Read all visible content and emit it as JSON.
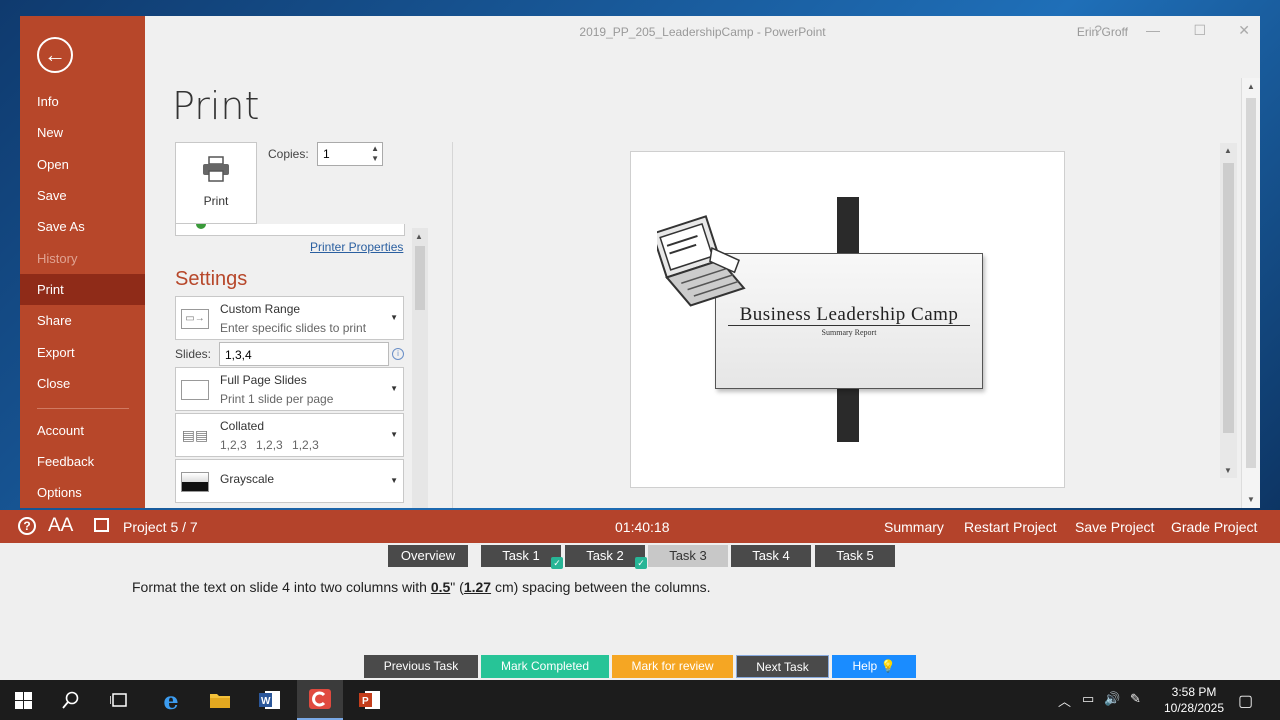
{
  "window": {
    "title": "2019_PP_205_LeadershipCamp  -  PowerPoint",
    "user": "Erin Groff",
    "help": "?",
    "minimize": "—",
    "maximize": "☐",
    "close": "✕"
  },
  "backstage": {
    "back": "←",
    "items": [
      {
        "label": "Info",
        "state": "normal"
      },
      {
        "label": "New",
        "state": "normal"
      },
      {
        "label": "Open",
        "state": "normal"
      },
      {
        "label": "Save",
        "state": "normal"
      },
      {
        "label": "Save As",
        "state": "normal"
      },
      {
        "label": "History",
        "state": "disabled"
      },
      {
        "label": "Print",
        "state": "active"
      },
      {
        "label": "Share",
        "state": "normal"
      },
      {
        "label": "Export",
        "state": "normal"
      },
      {
        "label": "Close",
        "state": "normal"
      },
      {
        "label": "Account",
        "state": "normal"
      },
      {
        "label": "Feedback",
        "state": "normal"
      },
      {
        "label": "Options",
        "state": "normal"
      }
    ]
  },
  "print": {
    "heading": "Print",
    "button_label": "Print",
    "copies_label": "Copies:",
    "copies_value": "1",
    "printer_properties": "Printer Properties",
    "settings_heading": "Settings",
    "range": {
      "title": "Custom Range",
      "subtitle": "Enter specific slides to print"
    },
    "slides_label": "Slides:",
    "slides_value": "1,3,4",
    "layout": {
      "title": "Full Page Slides",
      "subtitle": "Print 1 slide per page"
    },
    "collation": {
      "title": "Collated",
      "subtitle": "1,2,3   1,2,3   1,2,3"
    },
    "color": {
      "title": "Grayscale"
    }
  },
  "preview": {
    "slide_title": "Business Leadership Camp",
    "slide_subtitle": "Summary Report"
  },
  "exam": {
    "project": "Project 5 / 7",
    "timer": "01:40:18",
    "links": [
      "Summary",
      "Restart Project",
      "Save Project",
      "Grade Project"
    ],
    "tabs": [
      {
        "label": "Overview",
        "state": "normal"
      },
      {
        "label": "Task 1",
        "state": "completed"
      },
      {
        "label": "Task 2",
        "state": "completed"
      },
      {
        "label": "Task 3",
        "state": "current"
      },
      {
        "label": "Task 4",
        "state": "normal"
      },
      {
        "label": "Task 5",
        "state": "normal"
      }
    ],
    "task_pre": "Format the text on slide 4 into two columns with ",
    "task_val1": "0.5",
    "task_mid": "\" (",
    "task_val2": "1.27",
    "task_post": " cm) spacing between the columns.",
    "buttons": {
      "previous": "Previous Task",
      "complete": "Mark Completed",
      "review": "Mark for review",
      "next": "Next Task",
      "help": "Help"
    },
    "colors": {
      "bar": "#b4432b",
      "complete": "#27c497",
      "review": "#f5a623",
      "help": "#1a8cff",
      "dark": "#4a4a4a"
    }
  },
  "taskbar": {
    "time": "3:58 PM",
    "date": "10/28/2025",
    "icons": [
      "windows-icon",
      "search-icon",
      "task-view-icon",
      "edge-icon",
      "file-explorer-icon",
      "word-icon",
      "exam-app-icon",
      "powerpoint-icon"
    ]
  }
}
